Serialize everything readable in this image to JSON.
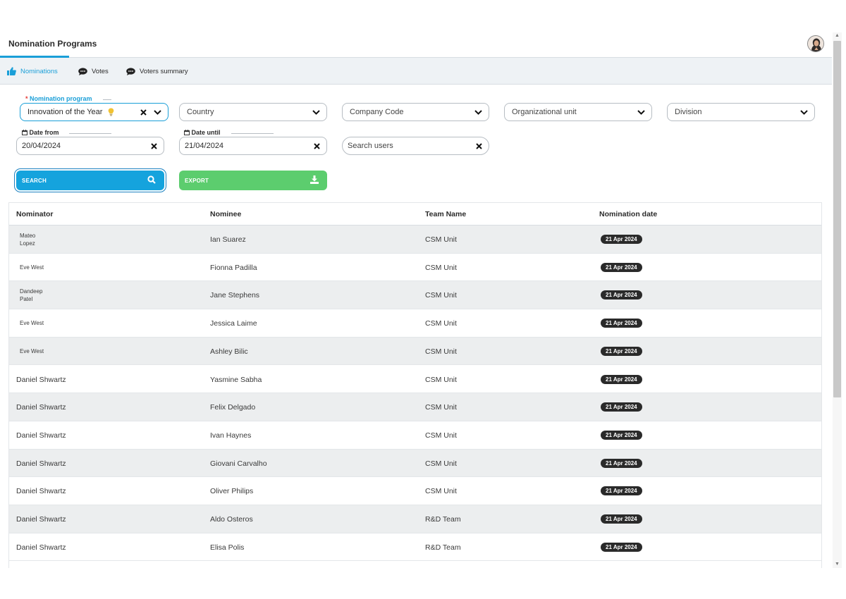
{
  "header": {
    "title": "Nomination Programs"
  },
  "tabs": [
    {
      "label": "Nominations",
      "icon": "thumbs-up-icon",
      "active": true
    },
    {
      "label": "Votes",
      "icon": "chat-bubble-icon"
    },
    {
      "label": "Voters summary",
      "icon": "chat-bubble-icon"
    }
  ],
  "filters": {
    "program": {
      "label": "Nomination program",
      "required_mark": "*",
      "value": "Innovation of the Year"
    },
    "country": {
      "placeholder": "Country"
    },
    "company_code": {
      "placeholder": "Company Code"
    },
    "org_unit": {
      "placeholder": "Organizational unit"
    },
    "division": {
      "placeholder": "Division"
    },
    "date_from": {
      "label": "Date from",
      "value": "20/04/2024"
    },
    "date_until": {
      "label": "Date until",
      "value": "21/04/2024"
    },
    "search_users": {
      "placeholder": "Search users"
    }
  },
  "actions": {
    "search_label": "SEARCH",
    "export_label": "EXPORT"
  },
  "table": {
    "columns": [
      "Nominator",
      "Nominee",
      "Team Name",
      "Nomination date"
    ],
    "rows": [
      {
        "nominator": "Mateo\nLopez",
        "nominee": "Ian Suarez",
        "team": "CSM Unit",
        "date": "21 Apr 2024"
      },
      {
        "nominator": "Eve West",
        "nominee": "Fionna Padilla",
        "team": "CSM Unit",
        "date": "21 Apr 2024"
      },
      {
        "nominator": "Dandeep\nPatel",
        "nominee": "Jane Stephens",
        "team": "CSM Unit",
        "date": "21 Apr 2024"
      },
      {
        "nominator": "Eve West",
        "nominee": "Jessica Laime",
        "team": "CSM Unit",
        "date": "21 Apr 2024"
      },
      {
        "nominator": "Eve West",
        "nominee": "Ashley Bilic",
        "team": "CSM Unit",
        "date": "21 Apr 2024"
      },
      {
        "nominator": "Daniel Shwartz",
        "nominee": "Yasmine Sabha",
        "team": "CSM Unit",
        "date": "21 Apr 2024"
      },
      {
        "nominator": "Daniel Shwartz",
        "nominee": "Felix Delgado",
        "team": "CSM Unit",
        "date": "21 Apr 2024"
      },
      {
        "nominator": "Daniel Shwartz",
        "nominee": "Ivan Haynes",
        "team": "CSM Unit",
        "date": "21 Apr 2024"
      },
      {
        "nominator": "Daniel Shwartz",
        "nominee": "Giovani Carvalho",
        "team": "CSM Unit",
        "date": "21 Apr 2024"
      },
      {
        "nominator": "Daniel Shwartz",
        "nominee": "Oliver Philips",
        "team": "CSM Unit",
        "date": "21 Apr 2024"
      },
      {
        "nominator": "Daniel Shwartz",
        "nominee": "Aldo Osteros",
        "team": "R&D Team",
        "date": "21 Apr 2024"
      },
      {
        "nominator": "Daniel Shwartz",
        "nominee": "Elisa Polis",
        "team": "R&D Team",
        "date": "21 Apr 2024"
      }
    ]
  },
  "colors": {
    "accent": "#1a9fd8",
    "export": "#5ccd6e",
    "badge": "#2a2a2a",
    "row_alt": "#eceeef"
  }
}
